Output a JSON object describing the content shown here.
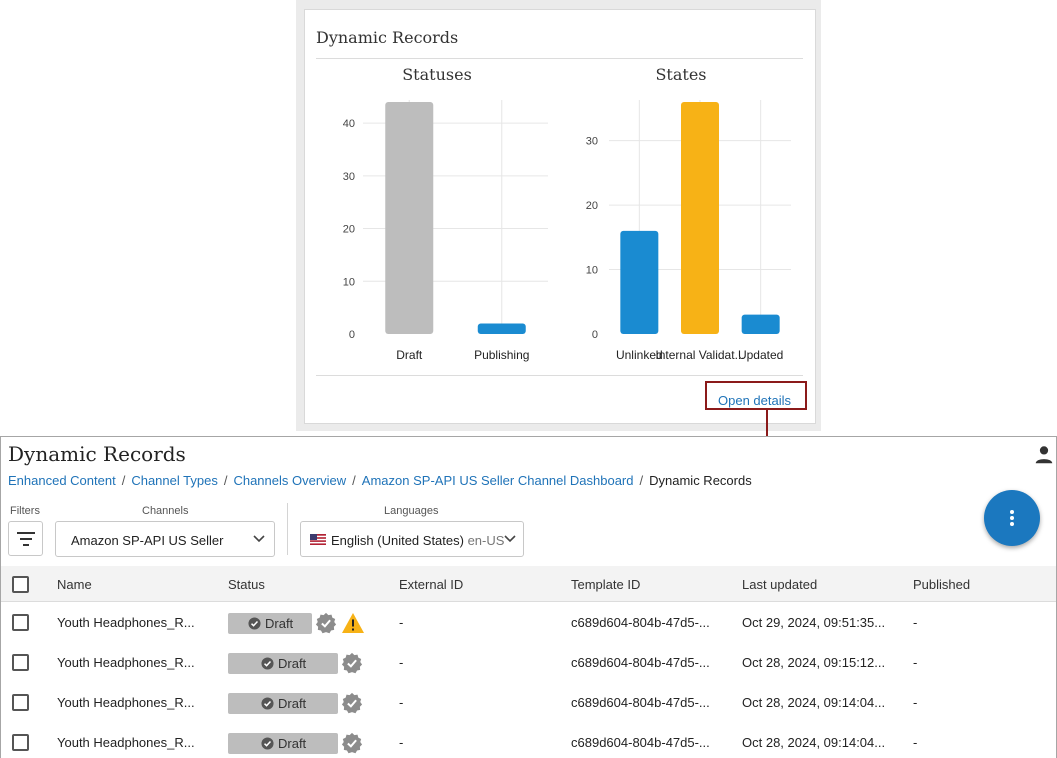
{
  "widget": {
    "title": "Dynamic Records",
    "open_details": "Open details"
  },
  "chart_data": [
    {
      "type": "bar",
      "title": "Statuses",
      "categories": [
        "Draft",
        "Publishing"
      ],
      "values": [
        44,
        2
      ],
      "colors": [
        "#bdbdbd",
        "#1a8bd1"
      ],
      "ylim": [
        0,
        44
      ],
      "yticks": [
        0,
        10,
        20,
        30,
        40
      ],
      "grid": "vertical"
    },
    {
      "type": "bar",
      "title": "States",
      "categories": [
        "Unlinked",
        "Internal Validat...",
        "Updated"
      ],
      "values": [
        16,
        36,
        3
      ],
      "colors": [
        "#1a8bd1",
        "#f7b216",
        "#1a8bd1"
      ],
      "ylim": [
        0,
        36
      ],
      "yticks": [
        0,
        10,
        20,
        30
      ],
      "grid": "vertical"
    }
  ],
  "page": {
    "title": "Dynamic Records",
    "breadcrumb": [
      "Enhanced Content",
      "Channel Types",
      "Channels Overview",
      "Amazon SP-API US Seller Channel Dashboard"
    ],
    "breadcrumb_sep": "/",
    "breadcrumb_current": "Dynamic Records"
  },
  "filters": {
    "filters_label": "Filters",
    "channels_label": "Channels",
    "channel_value": "Amazon SP-API US Seller",
    "languages_label": "Languages",
    "language_value": "English (United States)",
    "language_code": "en-US"
  },
  "table": {
    "columns": [
      "Name",
      "Status",
      "External ID",
      "Template ID",
      "Last updated",
      "Published"
    ],
    "rows": [
      {
        "name": "Youth Headphones_R...",
        "status": "Draft",
        "external_id": "-",
        "template_id": "c689d604-804b-47d5-...",
        "last_updated": "Oct 29, 2024, 09:51:35...",
        "published": "-",
        "warning": true
      },
      {
        "name": "Youth Headphones_R...",
        "status": "Draft",
        "external_id": "-",
        "template_id": "c689d604-804b-47d5-...",
        "last_updated": "Oct 28, 2024, 09:15:12...",
        "published": "-",
        "warning": false
      },
      {
        "name": "Youth Headphones_R...",
        "status": "Draft",
        "external_id": "-",
        "template_id": "c689d604-804b-47d5-...",
        "last_updated": "Oct 28, 2024, 09:14:04...",
        "published": "-",
        "warning": false
      },
      {
        "name": "Youth Headphones_R...",
        "status": "Draft",
        "external_id": "-",
        "template_id": "c689d604-804b-47d5-...",
        "last_updated": "Oct 28, 2024, 09:14:04...",
        "published": "-",
        "warning": false
      }
    ]
  },
  "colors": {
    "accent": "#1f73b8",
    "fab": "#1b78bf",
    "highlight_border": "#8b1a1a",
    "status_pill": "#bdbdbd",
    "warning": "#f7b216"
  },
  "icons": {
    "user": "user-icon",
    "filter": "filter-icon",
    "chevron": "chevron-down-icon",
    "more": "more-vertical-icon",
    "flag": "us-flag-icon",
    "verified": "verified-badge-icon",
    "warning": "warning-icon",
    "check": "check-circle-icon"
  }
}
